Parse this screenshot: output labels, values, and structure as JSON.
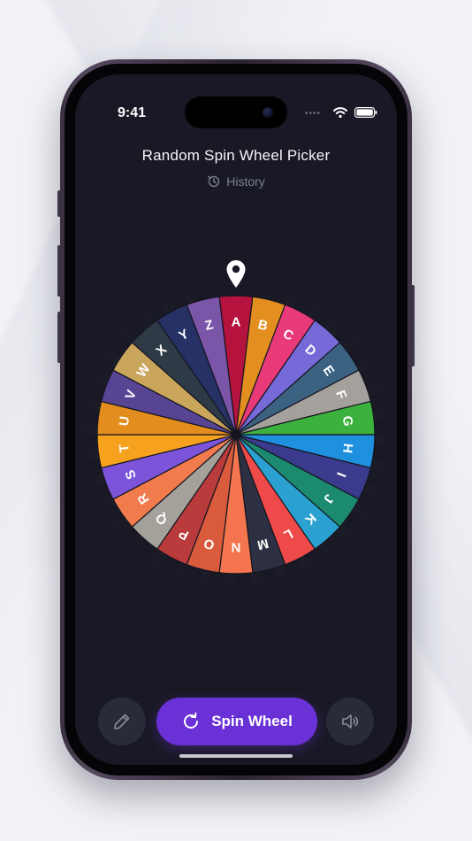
{
  "status_bar": {
    "time": "9:41"
  },
  "header": {
    "title": "Random Spin Wheel Picker",
    "history_label": "History"
  },
  "icons": {
    "history": "history-icon",
    "pin": "map-pin-icon",
    "edit": "pencil-icon",
    "spin": "refresh-icon",
    "sound": "speaker-icon",
    "wifi": "wifi-icon",
    "battery": "battery-icon"
  },
  "wheel": {
    "segments": [
      {
        "label": "A",
        "color": "#b5123e"
      },
      {
        "label": "B",
        "color": "#e28f1f"
      },
      {
        "label": "C",
        "color": "#e83a78"
      },
      {
        "label": "D",
        "color": "#7669d8"
      },
      {
        "label": "E",
        "color": "#3c6282"
      },
      {
        "label": "F",
        "color": "#a4a19c"
      },
      {
        "label": "G",
        "color": "#3db13e"
      },
      {
        "label": "H",
        "color": "#1e90dd"
      },
      {
        "label": "I",
        "color": "#3a3b8c"
      },
      {
        "label": "J",
        "color": "#1c8a6e"
      },
      {
        "label": "K",
        "color": "#2aa1d0"
      },
      {
        "label": "L",
        "color": "#ef4a4a"
      },
      {
        "label": "M",
        "color": "#2c3042"
      },
      {
        "label": "N",
        "color": "#f5764e"
      },
      {
        "label": "O",
        "color": "#da5a3c"
      },
      {
        "label": "P",
        "color": "#b93b3b"
      },
      {
        "label": "Q",
        "color": "#a3a19a"
      },
      {
        "label": "R",
        "color": "#f27b4e"
      },
      {
        "label": "S",
        "color": "#7b54da"
      },
      {
        "label": "T",
        "color": "#f6a21e"
      },
      {
        "label": "U",
        "color": "#e38d1e"
      },
      {
        "label": "V",
        "color": "#574492"
      },
      {
        "label": "W",
        "color": "#c9a65c"
      },
      {
        "label": "X",
        "color": "#2f3a47"
      },
      {
        "label": "Y",
        "color": "#263266"
      },
      {
        "label": "Z",
        "color": "#7b55a8"
      }
    ]
  },
  "controls": {
    "spin_label": "Spin Wheel"
  },
  "colors": {
    "accent": "#6a31d6",
    "screen_bg": "#191925"
  }
}
